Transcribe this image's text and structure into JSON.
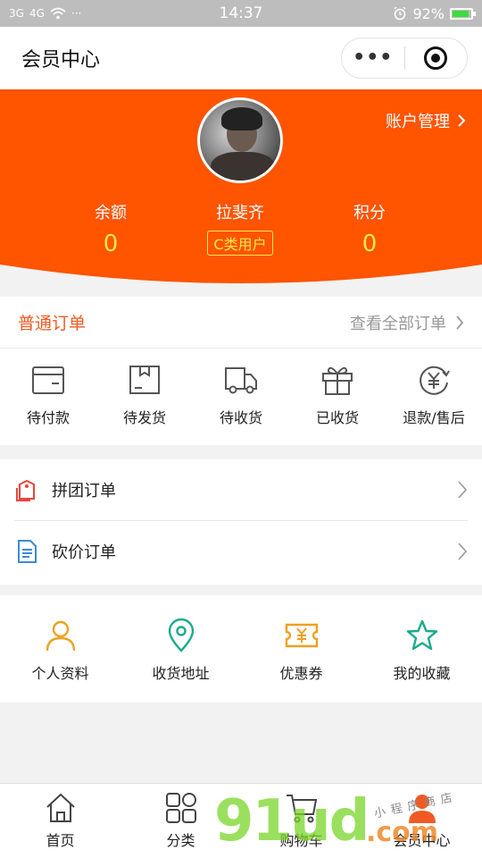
{
  "status_bar": {
    "signal": "3G",
    "signal2": "4G",
    "dots": "···",
    "time": "14:37",
    "battery": "92%",
    "battery_level": 0.92
  },
  "nav": {
    "title": "会员中心",
    "more": "•••"
  },
  "profile": {
    "account_manage": "账户管理",
    "balance_label": "余额",
    "balance_value": "0",
    "name": "拉斐齐",
    "user_tag": "C类用户",
    "points_label": "积分",
    "points_value": "0",
    "theme_color": "#ff5400",
    "value_color": "#ffe94a"
  },
  "orders": {
    "title": "普通订单",
    "view_all": "查看全部订单",
    "items": [
      {
        "label": "待付款",
        "icon": "wallet-icon"
      },
      {
        "label": "待发货",
        "icon": "box-icon"
      },
      {
        "label": "待收货",
        "icon": "truck-icon"
      },
      {
        "label": "已收货",
        "icon": "gift-icon"
      },
      {
        "label": "退款/售后",
        "icon": "refund-yen-icon"
      }
    ]
  },
  "list": [
    {
      "label": "拼团订单",
      "icon": "group-tag-icon"
    },
    {
      "label": "砍价订单",
      "icon": "document-icon"
    }
  ],
  "tools": [
    {
      "label": "个人资料",
      "icon": "person-icon"
    },
    {
      "label": "收货地址",
      "icon": "location-pin-icon"
    },
    {
      "label": "优惠券",
      "icon": "coupon-icon"
    },
    {
      "label": "我的收藏",
      "icon": "star-icon"
    }
  ],
  "tabs": [
    {
      "label": "首页",
      "icon": "home-icon"
    },
    {
      "label": "分类",
      "icon": "category-icon"
    },
    {
      "label": "购物车",
      "icon": "cart-icon"
    },
    {
      "label": "会员中心",
      "icon": "member-icon"
    }
  ],
  "watermark": {
    "main": "91ud",
    "suffix": ".com",
    "small": "小程序商店"
  }
}
